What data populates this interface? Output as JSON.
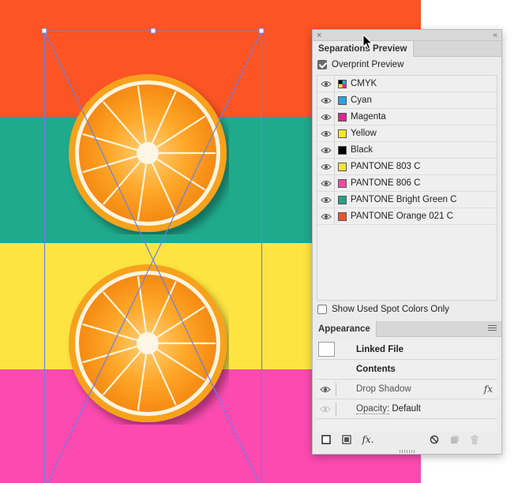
{
  "colors": {
    "band_orange": "#fc5424",
    "band_teal": "#1faa8c",
    "band_yellow": "#fde441",
    "band_pink": "#fc4ab0",
    "frame_stroke": "#6e7ee6"
  },
  "panel": {
    "close_glyph": "×",
    "collapse_glyph": "‹‹"
  },
  "separations": {
    "tab_label": "Separations Preview",
    "overprint_label": "Overprint Preview",
    "overprint_checked": true,
    "items": [
      {
        "name": "CMYK",
        "swatch": "cmyk-icon"
      },
      {
        "name": "Cyan",
        "swatch": "#27a5e3"
      },
      {
        "name": "Magenta",
        "swatch": "#e2228f"
      },
      {
        "name": "Yellow",
        "swatch": "#fbe824"
      },
      {
        "name": "Black",
        "swatch": "#000000"
      },
      {
        "name": "PANTONE 803 C",
        "swatch": "#f9e43a"
      },
      {
        "name": "PANTONE 806 C",
        "swatch": "#f04aa6"
      },
      {
        "name": "PANTONE Bright Green C",
        "swatch": "#23a383"
      },
      {
        "name": "PANTONE Orange 021 C",
        "swatch": "#f55228"
      }
    ],
    "spot_only_label": "Show Used Spot Colors Only",
    "spot_only_checked": false
  },
  "appearance": {
    "tab_label": "Appearance",
    "linked_file": "Linked File",
    "contents": "Contents",
    "drop_shadow": "Drop Shadow",
    "fx_badge": "fx",
    "opacity_label": "Opacity:",
    "opacity_value": "Default",
    "toolbar_icons": [
      "add-stroke-icon",
      "add-fill-icon",
      "add-effect-icon",
      "clear-appearance-icon",
      "duplicate-item-icon",
      "delete-item-icon"
    ],
    "add_effect_glyph": "fx."
  }
}
